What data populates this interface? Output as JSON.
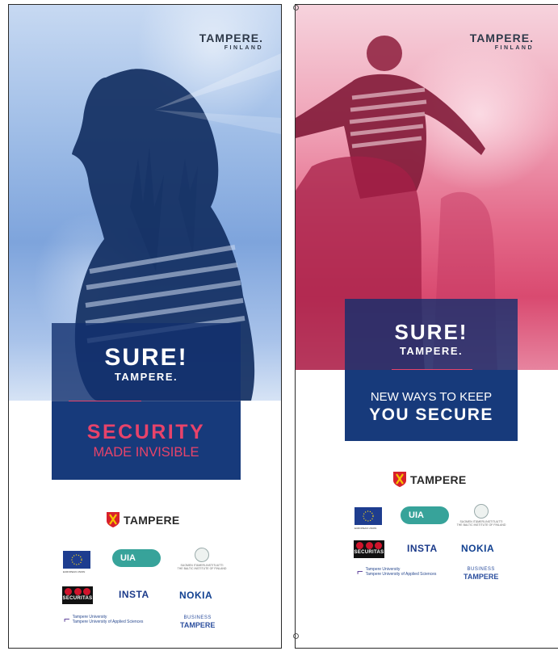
{
  "banner_left": {
    "logo": {
      "name": "TAMPERE.",
      "country": "FINLAND"
    },
    "headline": {
      "line1": "SURE!",
      "line2": "TAMPERE."
    },
    "tagline": {
      "line1": "SECURITY",
      "line2": "MADE INVISIBLE"
    },
    "city_logo": "TAMPERE",
    "partners": {
      "eu": "EUROPEAN UNION",
      "uia": "UIA",
      "baltic": [
        "SUOMEN ITÄMERI-INSTITUUTTI",
        "THE BALTIC INSTITUTE OF FINLAND"
      ],
      "securitas": "SECURITAS",
      "insta": "INSTA",
      "nokia": "NOKIA",
      "tuni": [
        "Tampere University",
        "Tampere University of Applied Sciences"
      ],
      "business_tampere": [
        "BUSINESS",
        "TAMPERE"
      ]
    }
  },
  "banner_right": {
    "logo": {
      "name": "TAMPERE.",
      "country": "FINLAND"
    },
    "headline": {
      "line1": "SURE!",
      "line2": "TAMPERE."
    },
    "tagline": {
      "line1": "NEW WAYS TO KEEP",
      "line2": "YOU SECURE"
    },
    "city_logo": "TAMPERE",
    "partners": {
      "eu": "EUROPEAN UNION",
      "uia": "UIA",
      "baltic": [
        "SUOMEN ITÄMERI-INSTITUUTTI",
        "THE BALTIC INSTITUTE OF FINLAND"
      ],
      "securitas": "SECURITAS",
      "insta": "INSTA",
      "nokia": "NOKIA",
      "tuni": [
        "Tampere University",
        "Tampere University of Applied Sciences"
      ],
      "business_tampere": [
        "BUSINESS",
        "TAMPERE"
      ]
    }
  },
  "colors": {
    "accent_pink": "#e8436a",
    "navy": "#173a7b",
    "blue_photo": "#7ea4dc",
    "pink_photo": "#e46a8a"
  }
}
